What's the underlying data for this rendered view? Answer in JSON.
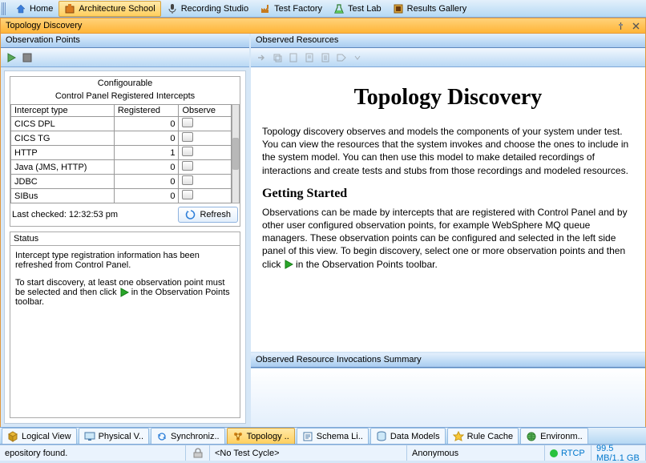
{
  "topnav": {
    "tabs": [
      {
        "label": "Home",
        "icon": "home-icon"
      },
      {
        "label": "Architecture School",
        "icon": "architecture-icon",
        "active": true
      },
      {
        "label": "Recording Studio",
        "icon": "microphone-icon"
      },
      {
        "label": "Test Factory",
        "icon": "factory-icon"
      },
      {
        "label": "Test Lab",
        "icon": "flask-icon"
      },
      {
        "label": "Results Gallery",
        "icon": "gallery-icon"
      }
    ]
  },
  "window": {
    "title": "Topology Discovery"
  },
  "left": {
    "header": "Observation Points",
    "config_title": "Configourable",
    "config_subtitle": "Control Panel Registered Intercepts",
    "columns": {
      "type": "Intercept type",
      "registered": "Registered",
      "observe": "Observe"
    },
    "rows": [
      {
        "type": "CICS DPL",
        "registered": 0
      },
      {
        "type": "CICS TG",
        "registered": 0
      },
      {
        "type": "HTTP",
        "registered": 1
      },
      {
        "type": "Java (JMS, HTTP)",
        "registered": 0
      },
      {
        "type": "JDBC",
        "registered": 0
      },
      {
        "type": "SIBus",
        "registered": 0
      }
    ],
    "last_checked_label": "Last checked: 12:32:53 pm",
    "refresh_label": "Refresh",
    "status_title": "Status",
    "status_p1": "Intercept type registration information has been refreshed from Control Panel.",
    "status_p2a": "To start discovery, at least one observation point must be selected and then click",
    "status_p2b": "in the Observation Points toolbar."
  },
  "right": {
    "header": "Observed Resources",
    "doc_title": "Topology Discovery",
    "doc_p1": "Topology discovery observes and models the components of your system under test. You can view the resources that the system invokes and choose the ones to include in the system model. You can then use this model to make detailed recordings of interactions and create tests and stubs from those recordings and modeled resources.",
    "doc_h2": "Getting Started",
    "doc_p2a": "Observations can be made by intercepts that are registered with Control Panel and by other user configured observation points, for example WebSphere MQ queue managers. These observation points can be configured and selected in the left side panel of this view. To begin discovery, select one or more observation points and then click",
    "doc_p2b": "in the Observation Points toolbar.",
    "invoc_header": "Observed Resource Invocations Summary"
  },
  "bottom_tabs": [
    {
      "label": "Logical View",
      "icon": "cube-icon"
    },
    {
      "label": "Physical V..",
      "icon": "monitor-icon"
    },
    {
      "label": "Synchroniz..",
      "icon": "sync-icon"
    },
    {
      "label": "Topology ..",
      "icon": "topology-icon",
      "active": true
    },
    {
      "label": "Schema Li..",
      "icon": "schema-icon"
    },
    {
      "label": "Data Models",
      "icon": "data-icon"
    },
    {
      "label": "Rule Cache",
      "icon": "star-icon"
    },
    {
      "label": "Environm..",
      "icon": "globe-icon"
    }
  ],
  "status_bar": {
    "repo": "epository found.",
    "cycle": "<No Test Cycle>",
    "user": "Anonymous",
    "rtcp": "RTCP",
    "mem": "99.5 MB/1.1 GB"
  }
}
